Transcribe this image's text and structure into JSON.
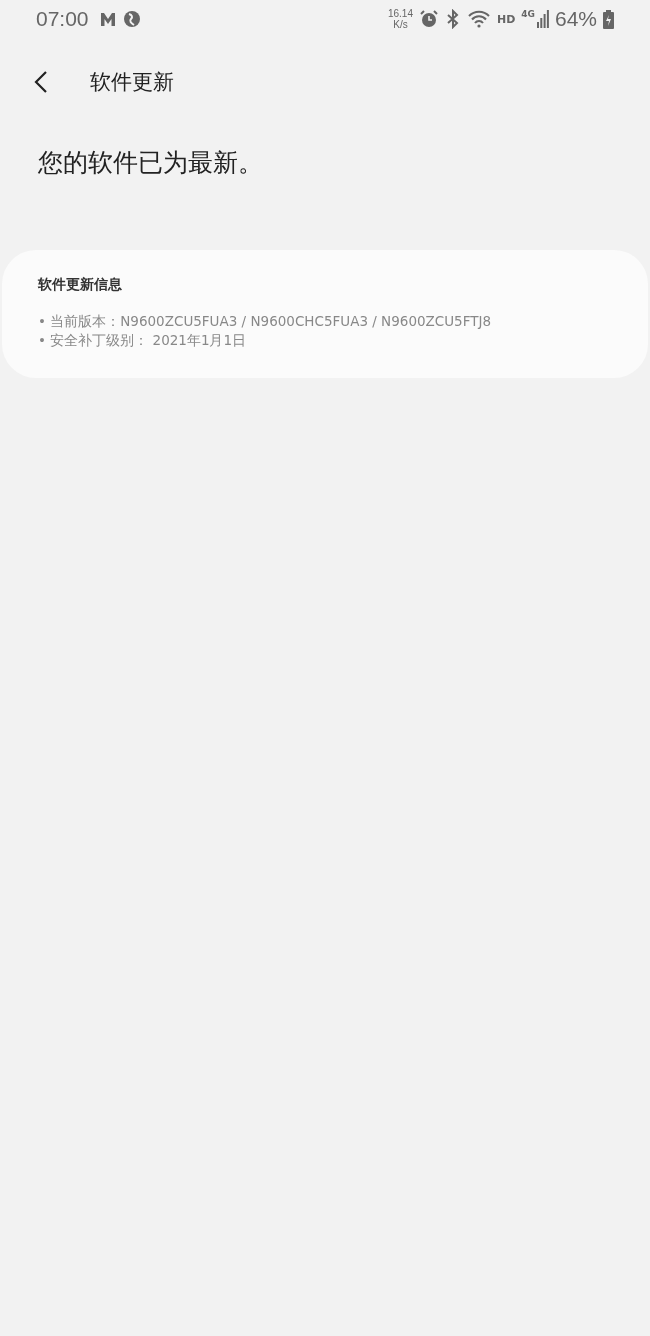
{
  "status_bar": {
    "time": "07:00",
    "speed_value": "16.14",
    "speed_unit": "K/s",
    "hd": "HD",
    "network": "4G",
    "battery": "64%"
  },
  "header": {
    "title": "软件更新"
  },
  "message": "您的软件已为最新。",
  "info_card": {
    "title": "软件更新信息",
    "lines": [
      "• 当前版本：N9600ZCU5FUA3 / N9600CHC5FUA3 / N9600ZCU5FTJ8",
      "• 安全补丁级别： 2021年1月1日"
    ]
  }
}
